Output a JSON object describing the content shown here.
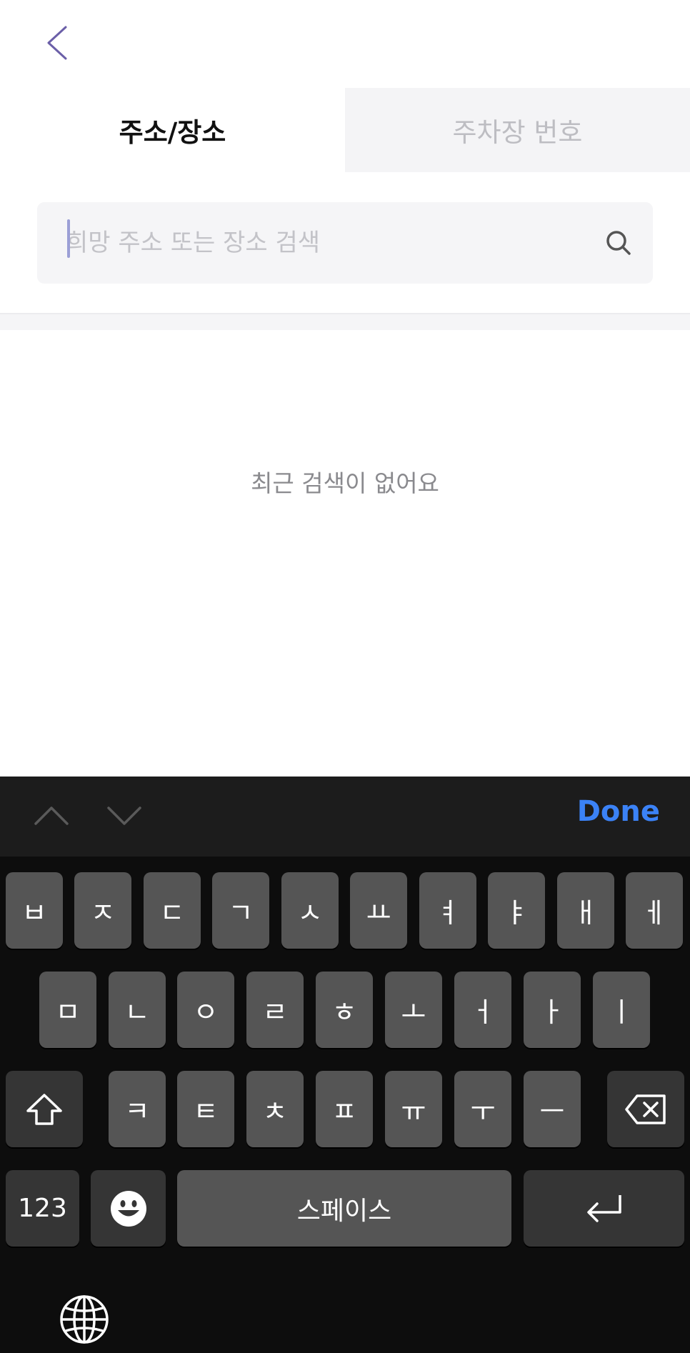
{
  "nav": {
    "back_icon": "chevron-left-icon"
  },
  "tabs": [
    {
      "label": "주소/장소",
      "active": true
    },
    {
      "label": "주차장 번호",
      "active": false
    }
  ],
  "search": {
    "placeholder": "희망 주소 또는 장소 검색",
    "value": "",
    "icon": "search-icon"
  },
  "empty_state": {
    "message": "최근 검색이 없어요"
  },
  "keyboard_toolbar": {
    "done_label": "Done",
    "done_color": "#3b82f6"
  },
  "keyboard": {
    "row1": [
      "ㅂ",
      "ㅈ",
      "ㄷ",
      "ㄱ",
      "ㅅ",
      "ㅛ",
      "ㅕ",
      "ㅑ",
      "ㅐ",
      "ㅔ"
    ],
    "row2": [
      "ㅁ",
      "ㄴ",
      "ㅇ",
      "ㄹ",
      "ㅎ",
      "ㅗ",
      "ㅓ",
      "ㅏ",
      "ㅣ"
    ],
    "row3": [
      "ㅋ",
      "ㅌ",
      "ㅊ",
      "ㅍ",
      "ㅠ",
      "ㅜ",
      "ㅡ"
    ],
    "numbers_label": "123",
    "space_label": "스페이스"
  }
}
